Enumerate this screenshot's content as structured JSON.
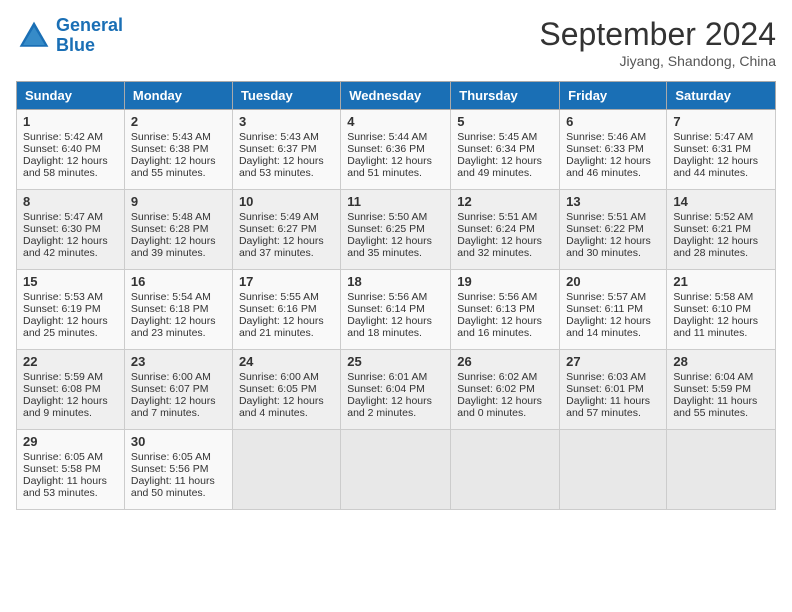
{
  "header": {
    "logo_line1": "General",
    "logo_line2": "Blue",
    "month_title": "September 2024",
    "location": "Jiyang, Shandong, China"
  },
  "days_of_week": [
    "Sunday",
    "Monday",
    "Tuesday",
    "Wednesday",
    "Thursday",
    "Friday",
    "Saturday"
  ],
  "weeks": [
    [
      {
        "day": "1",
        "lines": [
          "Sunrise: 5:42 AM",
          "Sunset: 6:40 PM",
          "Daylight: 12 hours",
          "and 58 minutes."
        ]
      },
      {
        "day": "2",
        "lines": [
          "Sunrise: 5:43 AM",
          "Sunset: 6:38 PM",
          "Daylight: 12 hours",
          "and 55 minutes."
        ]
      },
      {
        "day": "3",
        "lines": [
          "Sunrise: 5:43 AM",
          "Sunset: 6:37 PM",
          "Daylight: 12 hours",
          "and 53 minutes."
        ]
      },
      {
        "day": "4",
        "lines": [
          "Sunrise: 5:44 AM",
          "Sunset: 6:36 PM",
          "Daylight: 12 hours",
          "and 51 minutes."
        ]
      },
      {
        "day": "5",
        "lines": [
          "Sunrise: 5:45 AM",
          "Sunset: 6:34 PM",
          "Daylight: 12 hours",
          "and 49 minutes."
        ]
      },
      {
        "day": "6",
        "lines": [
          "Sunrise: 5:46 AM",
          "Sunset: 6:33 PM",
          "Daylight: 12 hours",
          "and 46 minutes."
        ]
      },
      {
        "day": "7",
        "lines": [
          "Sunrise: 5:47 AM",
          "Sunset: 6:31 PM",
          "Daylight: 12 hours",
          "and 44 minutes."
        ]
      }
    ],
    [
      {
        "day": "8",
        "lines": [
          "Sunrise: 5:47 AM",
          "Sunset: 6:30 PM",
          "Daylight: 12 hours",
          "and 42 minutes."
        ]
      },
      {
        "day": "9",
        "lines": [
          "Sunrise: 5:48 AM",
          "Sunset: 6:28 PM",
          "Daylight: 12 hours",
          "and 39 minutes."
        ]
      },
      {
        "day": "10",
        "lines": [
          "Sunrise: 5:49 AM",
          "Sunset: 6:27 PM",
          "Daylight: 12 hours",
          "and 37 minutes."
        ]
      },
      {
        "day": "11",
        "lines": [
          "Sunrise: 5:50 AM",
          "Sunset: 6:25 PM",
          "Daylight: 12 hours",
          "and 35 minutes."
        ]
      },
      {
        "day": "12",
        "lines": [
          "Sunrise: 5:51 AM",
          "Sunset: 6:24 PM",
          "Daylight: 12 hours",
          "and 32 minutes."
        ]
      },
      {
        "day": "13",
        "lines": [
          "Sunrise: 5:51 AM",
          "Sunset: 6:22 PM",
          "Daylight: 12 hours",
          "and 30 minutes."
        ]
      },
      {
        "day": "14",
        "lines": [
          "Sunrise: 5:52 AM",
          "Sunset: 6:21 PM",
          "Daylight: 12 hours",
          "and 28 minutes."
        ]
      }
    ],
    [
      {
        "day": "15",
        "lines": [
          "Sunrise: 5:53 AM",
          "Sunset: 6:19 PM",
          "Daylight: 12 hours",
          "and 25 minutes."
        ]
      },
      {
        "day": "16",
        "lines": [
          "Sunrise: 5:54 AM",
          "Sunset: 6:18 PM",
          "Daylight: 12 hours",
          "and 23 minutes."
        ]
      },
      {
        "day": "17",
        "lines": [
          "Sunrise: 5:55 AM",
          "Sunset: 6:16 PM",
          "Daylight: 12 hours",
          "and 21 minutes."
        ]
      },
      {
        "day": "18",
        "lines": [
          "Sunrise: 5:56 AM",
          "Sunset: 6:14 PM",
          "Daylight: 12 hours",
          "and 18 minutes."
        ]
      },
      {
        "day": "19",
        "lines": [
          "Sunrise: 5:56 AM",
          "Sunset: 6:13 PM",
          "Daylight: 12 hours",
          "and 16 minutes."
        ]
      },
      {
        "day": "20",
        "lines": [
          "Sunrise: 5:57 AM",
          "Sunset: 6:11 PM",
          "Daylight: 12 hours",
          "and 14 minutes."
        ]
      },
      {
        "day": "21",
        "lines": [
          "Sunrise: 5:58 AM",
          "Sunset: 6:10 PM",
          "Daylight: 12 hours",
          "and 11 minutes."
        ]
      }
    ],
    [
      {
        "day": "22",
        "lines": [
          "Sunrise: 5:59 AM",
          "Sunset: 6:08 PM",
          "Daylight: 12 hours",
          "and 9 minutes."
        ]
      },
      {
        "day": "23",
        "lines": [
          "Sunrise: 6:00 AM",
          "Sunset: 6:07 PM",
          "Daylight: 12 hours",
          "and 7 minutes."
        ]
      },
      {
        "day": "24",
        "lines": [
          "Sunrise: 6:00 AM",
          "Sunset: 6:05 PM",
          "Daylight: 12 hours",
          "and 4 minutes."
        ]
      },
      {
        "day": "25",
        "lines": [
          "Sunrise: 6:01 AM",
          "Sunset: 6:04 PM",
          "Daylight: 12 hours",
          "and 2 minutes."
        ]
      },
      {
        "day": "26",
        "lines": [
          "Sunrise: 6:02 AM",
          "Sunset: 6:02 PM",
          "Daylight: 12 hours",
          "and 0 minutes."
        ]
      },
      {
        "day": "27",
        "lines": [
          "Sunrise: 6:03 AM",
          "Sunset: 6:01 PM",
          "Daylight: 11 hours",
          "and 57 minutes."
        ]
      },
      {
        "day": "28",
        "lines": [
          "Sunrise: 6:04 AM",
          "Sunset: 5:59 PM",
          "Daylight: 11 hours",
          "and 55 minutes."
        ]
      }
    ],
    [
      {
        "day": "29",
        "lines": [
          "Sunrise: 6:05 AM",
          "Sunset: 5:58 PM",
          "Daylight: 11 hours",
          "and 53 minutes."
        ]
      },
      {
        "day": "30",
        "lines": [
          "Sunrise: 6:05 AM",
          "Sunset: 5:56 PM",
          "Daylight: 11 hours",
          "and 50 minutes."
        ]
      },
      null,
      null,
      null,
      null,
      null
    ]
  ]
}
